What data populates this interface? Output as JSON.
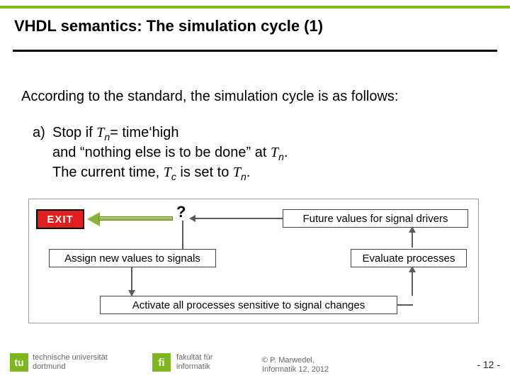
{
  "title": "VHDL semantics: The simulation cycle (1)",
  "intro": "According to the standard, the simulation cycle is as follows:",
  "item": {
    "marker": "a)",
    "line1_a": "Stop if ",
    "line1_tn": "T",
    "line1_n": "n",
    "line1_b": "= time‘high",
    "line2_a": "and “nothing else is to be done” at ",
    "line2_tn": "T",
    "line2_n": "n",
    "line2_b": ".",
    "line3_a": "The current time, ",
    "line3_tc": "T",
    "line3_c": "c",
    "line3_b": " is set to ",
    "line3_tn": "T",
    "line3_n2": "n",
    "line3_c2": "."
  },
  "diagram": {
    "exit": "EXIT",
    "q": "?",
    "future": "Future values for signal drivers",
    "assign": "Assign new values to signals",
    "evaluate": "Evaluate processes",
    "activate": "Activate all processes sensitive to signal changes"
  },
  "footer": {
    "tu_initials": "tu",
    "tu_line1": "technische universität",
    "tu_line2": "dortmund",
    "fi_initials": "fi",
    "fi_line1": "fakultät für",
    "fi_line2": "informatik",
    "copy_line1": "© P. Marwedel,",
    "copy_line2": "Informatik 12,  2012",
    "page": "-  12 -"
  }
}
